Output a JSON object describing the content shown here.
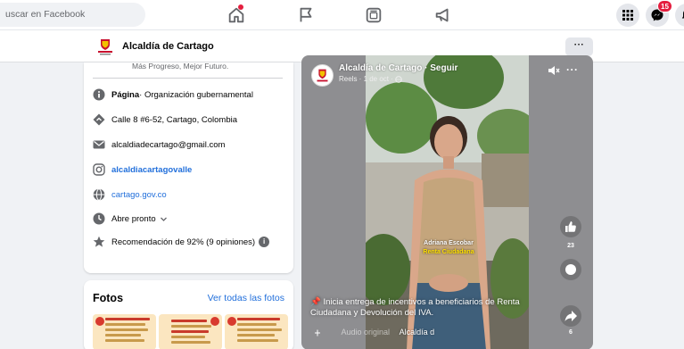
{
  "topbar": {
    "search_placeholder": "uscar en Facebook",
    "notification_count": "15",
    "icons": [
      "home-icon",
      "flag-icon",
      "video-icon",
      "megaphone-icon",
      "grid-menu-icon",
      "messenger-icon",
      "bell-icon"
    ],
    "accent_color": "#1877f2",
    "badge_color": "#e41e3f"
  },
  "page_header": {
    "name": "Alcaldía de Cartago",
    "more_label": "···"
  },
  "intro": {
    "slogan": "Más Progreso, Mejor Futuro.",
    "category_label": "Página",
    "category_value": " · Organización gubernamental",
    "address": "Calle 8 #6-52, Cartago, Colombia",
    "email": "alcaldiadecartago@gmail.com",
    "instagram": "alcaldiacartagovalle",
    "website": "cartago.gov.co",
    "hours": "Abre pronto",
    "recommendation": "Recomendación de 92% (9 opiniones)"
  },
  "photos": {
    "title": "Fotos",
    "see_all": "Ver todas las fotos"
  },
  "post": {
    "title": "Alcaldía de Cartago · Seguir",
    "meta": "Reels · 1 de oct · ",
    "name_overlay": "Adriana Escobar",
    "subtitle_overlay": "Renta Ciudadana",
    "like_count": "23",
    "share_count": "6",
    "caption": "📌 Inicia entrega de incentivos a beneficiarios de Renta Ciudadana y Devolución del IVA.",
    "audio_label": "Audio original",
    "audio_author": "Alcaldía d",
    "more_label": "···"
  }
}
